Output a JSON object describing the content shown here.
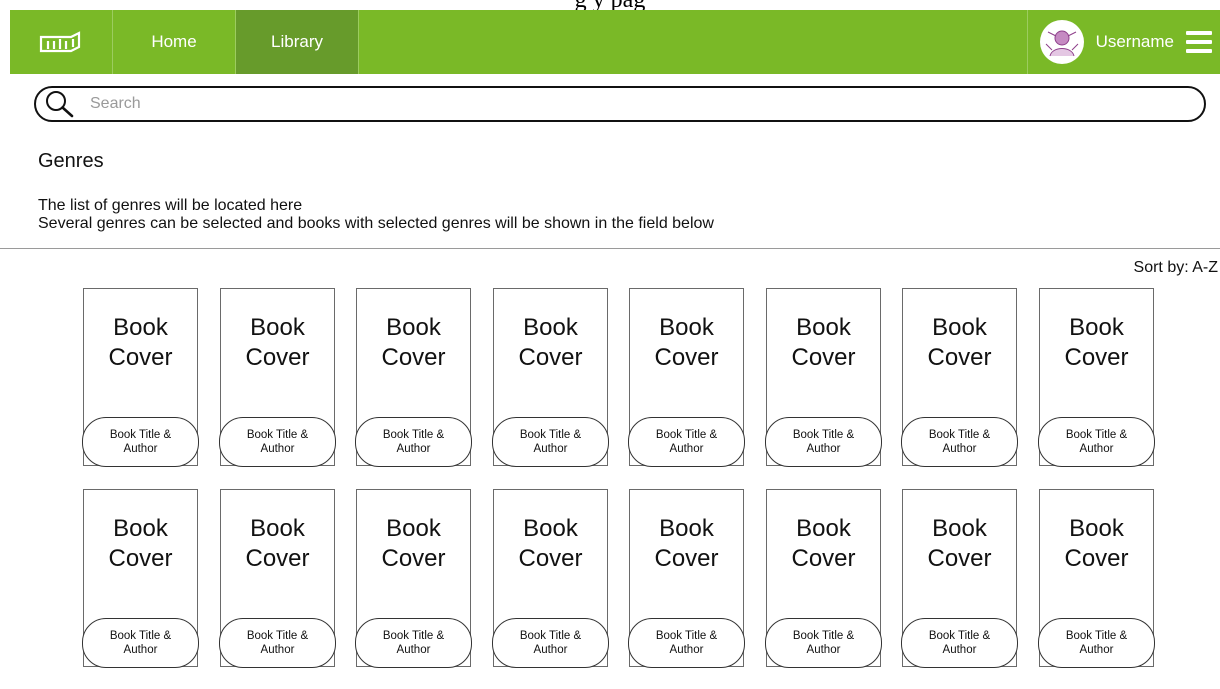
{
  "page_caption": "g    y pag",
  "navbar": {
    "logo_icon": "bookshelf-logo-icon",
    "items": [
      {
        "label": "Home",
        "active": false
      },
      {
        "label": "Library",
        "active": true
      }
    ],
    "user": {
      "name": "Username",
      "avatar_icon": "avatar-icon",
      "menu_icon": "hamburger-icon"
    },
    "colors": {
      "bar": "#7ab927",
      "active": "#679b2b"
    }
  },
  "search": {
    "placeholder": "Search",
    "value": "",
    "icon": "search-icon"
  },
  "genres": {
    "title": "Genres",
    "line1": "The list of genres will be located here",
    "line2": "Several genres can be selected and books with selected genres will be shown in the field below"
  },
  "sort": {
    "label": "Sort by: A-Z"
  },
  "books": [
    {
      "cover": [
        "Book",
        "Cover"
      ],
      "caption": "Book Title & Author"
    },
    {
      "cover": [
        "Book",
        "Cover"
      ],
      "caption": "Book Title & Author"
    },
    {
      "cover": [
        "Book",
        "Cover"
      ],
      "caption": "Book Title & Author"
    },
    {
      "cover": [
        "Book",
        "Cover"
      ],
      "caption": "Book Title & Author"
    },
    {
      "cover": [
        "Book",
        "Cover"
      ],
      "caption": "Book Title & Author"
    },
    {
      "cover": [
        "Book",
        "Cover"
      ],
      "caption": "Book Title & Author"
    },
    {
      "cover": [
        "Book",
        "Cover"
      ],
      "caption": "Book Title & Author"
    },
    {
      "cover": [
        "Book",
        "Cover"
      ],
      "caption": "Book Title & Author"
    },
    {
      "cover": [
        "Book",
        "Cover"
      ],
      "caption": "Book Title & Author"
    },
    {
      "cover": [
        "Book",
        "Cover"
      ],
      "caption": "Book Title & Author"
    },
    {
      "cover": [
        "Book",
        "Cover"
      ],
      "caption": "Book Title & Author"
    },
    {
      "cover": [
        "Book",
        "Cover"
      ],
      "caption": "Book Title & Author"
    },
    {
      "cover": [
        "Book",
        "Cover"
      ],
      "caption": "Book Title & Author"
    },
    {
      "cover": [
        "Book",
        "Cover"
      ],
      "caption": "Book Title & Author"
    },
    {
      "cover": [
        "Book",
        "Cover"
      ],
      "caption": "Book Title & Author"
    },
    {
      "cover": [
        "Book",
        "Cover"
      ],
      "caption": "Book Title & Author"
    }
  ]
}
